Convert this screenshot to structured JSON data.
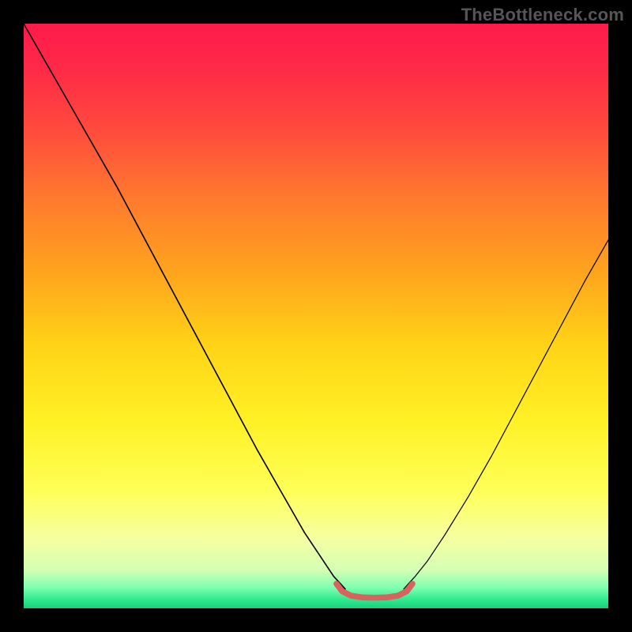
{
  "watermark": "TheBottleneck.com",
  "chart_data": {
    "type": "line",
    "title": "",
    "xlabel": "",
    "ylabel": "",
    "xlim": [
      0,
      100
    ],
    "ylim": [
      0,
      100
    ],
    "grid": false,
    "legend": false,
    "background_gradient_stops": [
      {
        "offset": 0.0,
        "color": "#ff1a4b"
      },
      {
        "offset": 0.08,
        "color": "#ff2a47"
      },
      {
        "offset": 0.18,
        "color": "#ff4a3d"
      },
      {
        "offset": 0.3,
        "color": "#ff7a2e"
      },
      {
        "offset": 0.42,
        "color": "#ffa21e"
      },
      {
        "offset": 0.55,
        "color": "#ffd316"
      },
      {
        "offset": 0.68,
        "color": "#fff126"
      },
      {
        "offset": 0.8,
        "color": "#ffff58"
      },
      {
        "offset": 0.88,
        "color": "#f6ffa1"
      },
      {
        "offset": 0.935,
        "color": "#d4ffb4"
      },
      {
        "offset": 0.965,
        "color": "#7dffb0"
      },
      {
        "offset": 0.985,
        "color": "#2fe98f"
      },
      {
        "offset": 1.0,
        "color": "#18cf7a"
      }
    ],
    "series": [
      {
        "name": "curve-left",
        "stroke": "#000000",
        "stroke_width": 1.6,
        "x": [
          0,
          4,
          8,
          12,
          16,
          20,
          24,
          28,
          32,
          36,
          40,
          44,
          48,
          51,
          53,
          55
        ],
        "y": [
          100,
          93,
          86,
          79,
          72,
          64.5,
          57,
          49.5,
          42,
          34.5,
          27,
          20,
          13,
          8.5,
          5.5,
          3.3
        ]
      },
      {
        "name": "curve-right",
        "stroke": "#000000",
        "stroke_width": 1.2,
        "x": [
          65,
          67,
          69,
          72,
          76,
          80,
          84,
          88,
          92,
          96,
          100
        ],
        "y": [
          3.3,
          5.5,
          8.0,
          12.5,
          19,
          26,
          33.5,
          41,
          48.5,
          56,
          63
        ]
      },
      {
        "name": "flat-band",
        "stroke": "#d8625e",
        "stroke_width": 7.5,
        "x": [
          53.5,
          54.5,
          56,
          58,
          60,
          62,
          64,
          65.5,
          66.5
        ],
        "y": [
          4.2,
          2.9,
          2.15,
          1.85,
          1.8,
          1.85,
          2.15,
          2.9,
          4.2
        ]
      }
    ]
  }
}
